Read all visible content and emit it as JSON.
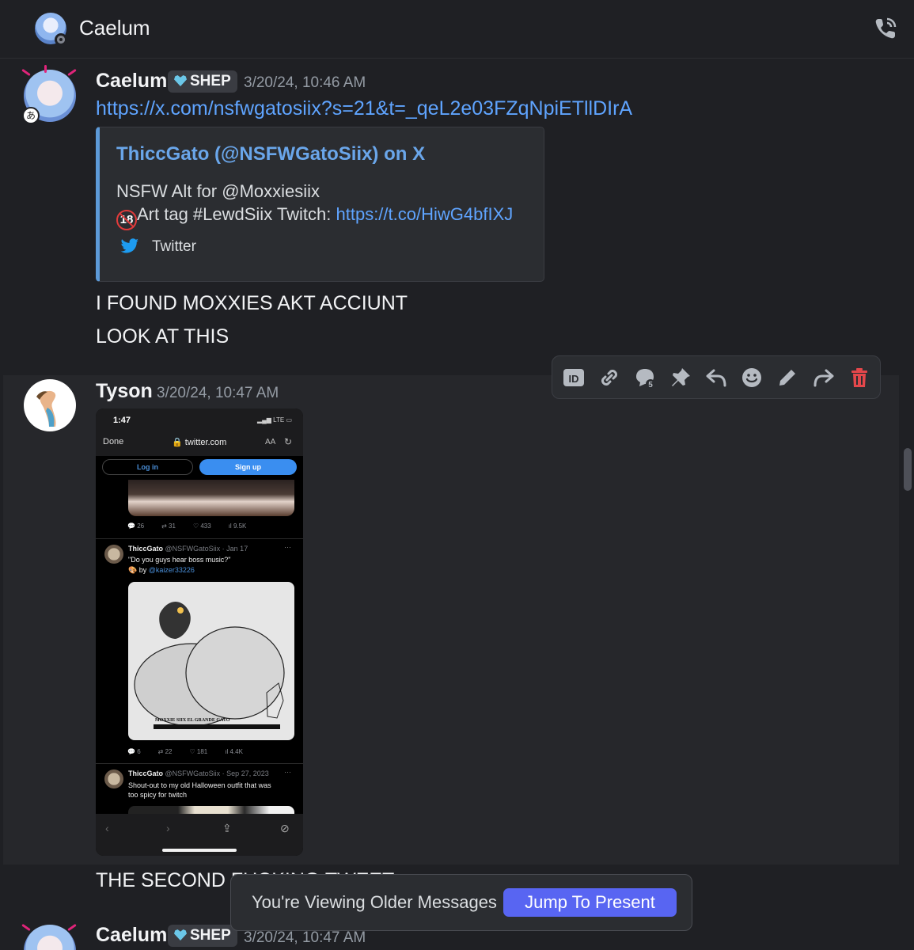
{
  "header": {
    "title": "Caelum"
  },
  "messages": [
    {
      "username": "Caelum",
      "tag": "SHEP",
      "timestamp": "3/20/24, 10:46 AM",
      "link": "https://x.com/nsfwgatosiix?s=21&t=_qeL2e03FZqNpiETllDIrA",
      "embed": {
        "title": "ThiccGato (@NSFWGatoSiix) on X",
        "line1": "NSFW Alt for @Moxxiesiix",
        "badge": "18",
        "line2_text": "Art tag #LewdSiix Twitch: ",
        "line2_link": "https://t.co/HiwG4bfIXJ",
        "footer": "Twitter"
      },
      "lines": [
        "I FOUND MOXXIES AKT ACCIUNT",
        "LOOK AT THIS"
      ]
    },
    {
      "username": "Tyson",
      "timestamp": "3/20/24, 10:47 AM",
      "text": "THE SECOND FUCKING TWEET",
      "phone": {
        "time": "1:47",
        "signal": "LTE",
        "done": "Done",
        "url": "twitter.com",
        "aa": "AA",
        "login": "Log in",
        "signup": "Sign up",
        "stats1": [
          "26",
          "31",
          "433",
          "9.5K"
        ],
        "tweet1": {
          "name": "ThiccGato",
          "handle": "@NSFWGatoSiix · Jan 17",
          "text": "\"Do you guys hear boss music?\"",
          "by": "by ",
          "by_link": "@kaizer33226",
          "caption": "MOXXIE SIIX EL GRANDE GATO"
        },
        "stats2": [
          "6",
          "22",
          "181",
          "4.4K"
        ],
        "tweet2": {
          "name": "ThiccGato",
          "handle": "@NSFWGatoSiix · Sep 27, 2023",
          "line1": "Shout-out to my old Halloween outfit that was",
          "line2": "too spicy for twitch"
        }
      }
    },
    {
      "username": "Caelum",
      "tag": "SHEP",
      "timestamp": "3/20/24, 10:47 AM"
    }
  ],
  "toolbar": {
    "icons": [
      "id-icon",
      "link-icon",
      "thread-icon",
      "pin-icon",
      "reply-icon",
      "reaction-icon",
      "edit-icon",
      "forward-icon",
      "delete-icon"
    ]
  },
  "jump": {
    "info": "You're Viewing Older Messages",
    "button": "Jump To Present"
  },
  "colors": {
    "background": "#1f2024",
    "link": "#5fa4ff",
    "accent": "#5865f2",
    "delete": "#e4474b"
  }
}
